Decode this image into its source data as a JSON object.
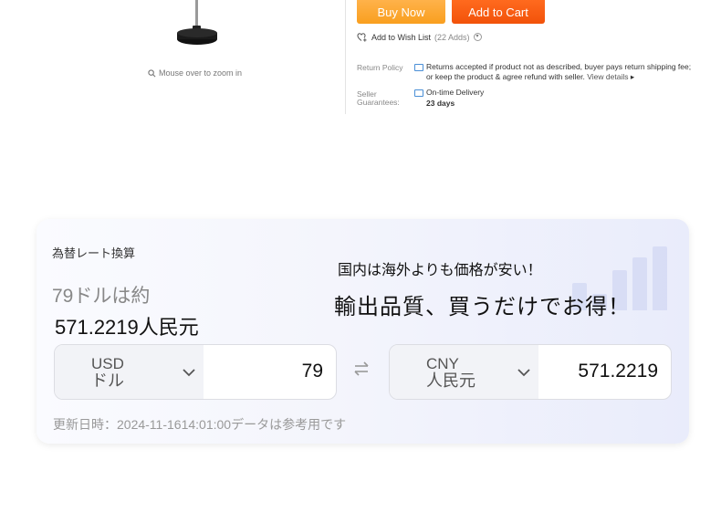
{
  "product": {
    "zoom_hint": "Mouse over to zoom in",
    "buy_now": "Buy Now",
    "add_to_cart": "Add to Cart",
    "wishlist_label": "Add to Wish List",
    "wishlist_count": "(22 Adds)",
    "return_policy_label": "Return Policy",
    "return_policy_line1": "Returns accepted if product not as described, buyer pays return shipping fee;",
    "return_policy_line2": "or keep the product & agree refund with seller.",
    "view_details": "View details",
    "seller_label_1": "Seller",
    "seller_label_2": "Guarantees:",
    "delivery_label": "On-time Delivery",
    "delivery_days": "23 days"
  },
  "converter": {
    "title": "為替レート換算",
    "approx_text": "79ドルは約",
    "result_text": "571.2219人民元",
    "promo_line1": "国内は海外よりも価格が安い！",
    "promo_line2": "輸出品質、買うだけでお得！",
    "from": {
      "code": "USD",
      "name": "ドル",
      "amount": "79"
    },
    "to": {
      "code": "CNY",
      "name": "人民元",
      "amount": "571.2219"
    },
    "updated": "更新日時：2024-11-1614:01:00データは参考用です"
  },
  "icons": {
    "zoom": "magnifier-icon",
    "wishlist": "heart-plus-icon",
    "swap": "swap-arrows-icon",
    "dropdown": "chevron-down-icon"
  },
  "colors": {
    "buy_now": "#f99f1f",
    "add_to_cart": "#f2520a",
    "link_blue": "#4a8fd6"
  }
}
